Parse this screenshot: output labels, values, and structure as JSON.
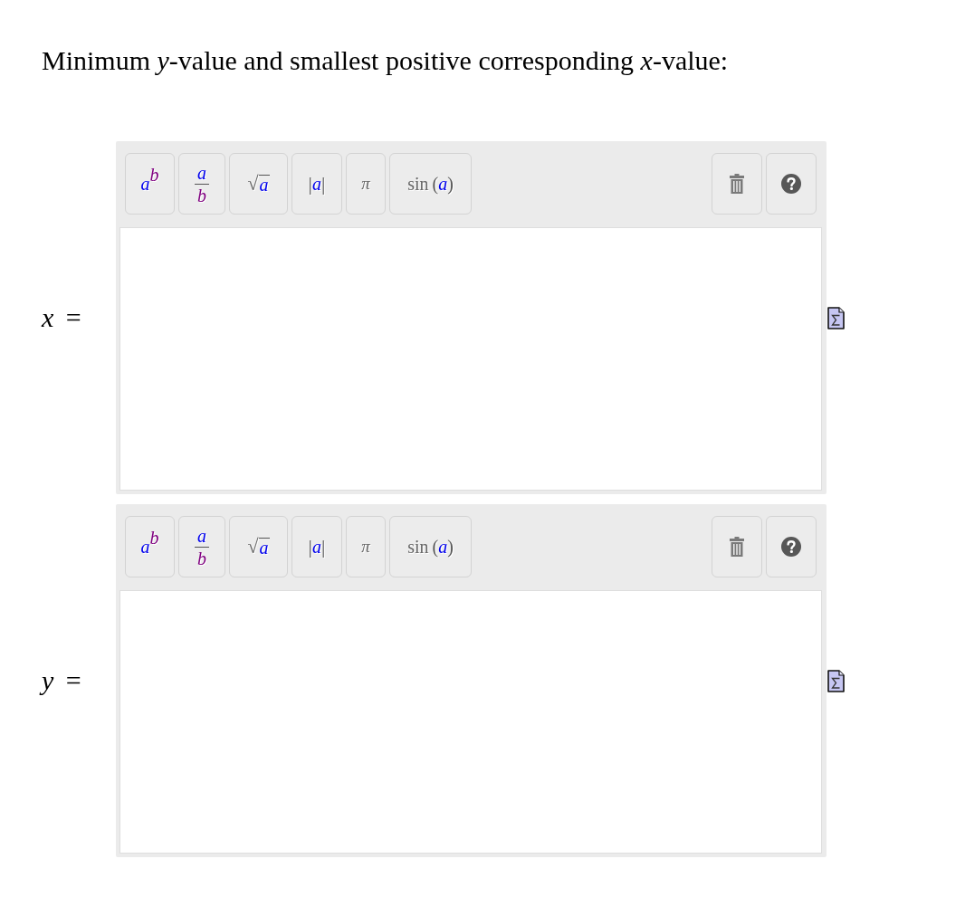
{
  "prompt": "Minimum *y*-value and smallest positive corresponding *x*-value:",
  "answers": [
    {
      "label": "*x* =",
      "toolbar": [
        {
          "kind": "power",
          "base": "a",
          "exponent": "b"
        },
        {
          "kind": "fraction",
          "numerator": "a",
          "denominator": "b"
        },
        {
          "kind": "sqrt",
          "radical": "√",
          "operand": "a"
        },
        {
          "kind": "abs",
          "left": "|",
          "operand": "a",
          "right": "|"
        },
        {
          "kind": "symbol",
          "text": "π"
        },
        {
          "kind": "function",
          "name": "sin",
          "open": "(",
          "operand": "a",
          "close": ")"
        }
      ],
      "tools": [
        {
          "kind": "delete"
        },
        {
          "kind": "help"
        }
      ]
    },
    {
      "label": "*y* =",
      "toolbar": [
        {
          "kind": "power",
          "base": "a",
          "exponent": "b"
        },
        {
          "kind": "fraction",
          "numerator": "a",
          "denominator": "b"
        },
        {
          "kind": "sqrt",
          "radical": "√",
          "operand": "a"
        },
        {
          "kind": "abs",
          "left": "|",
          "operand": "a",
          "right": "|"
        },
        {
          "kind": "symbol",
          "text": "π"
        },
        {
          "kind": "function",
          "name": "sin",
          "open": "(",
          "operand": "a",
          "close": ")"
        }
      ],
      "tools": [
        {
          "kind": "delete"
        },
        {
          "kind": "help"
        }
      ]
    }
  ]
}
